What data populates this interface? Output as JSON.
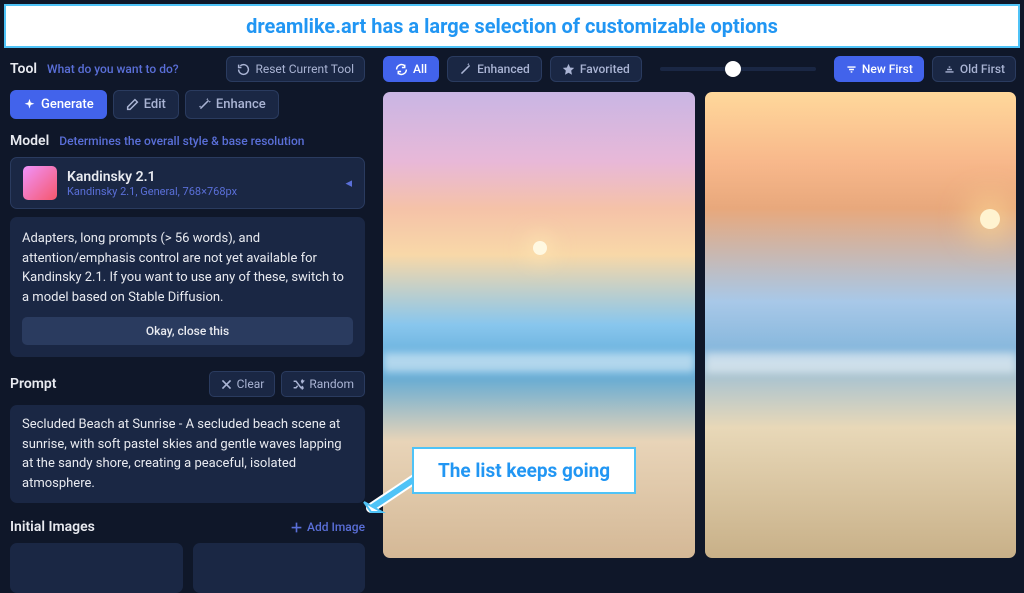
{
  "annotations": {
    "top": "dreamlike.art has a large selection of customizable options",
    "list": "The list keeps going"
  },
  "sidebar": {
    "tool": {
      "label": "Tool",
      "hint": "What do you want to do?",
      "reset": "Reset Current Tool",
      "generate": "Generate",
      "edit": "Edit",
      "enhance": "Enhance"
    },
    "model": {
      "label": "Model",
      "hint": "Determines the overall style & base resolution",
      "name": "Kandinsky 2.1",
      "details": "Kandinsky 2.1, General, 768×768px"
    },
    "notice": {
      "text": "Adapters, long prompts (> 56 words), and attention/emphasis control are not yet available for Kandinsky 2.1. If you want to use any of these, switch to a model based on Stable Diffusion.",
      "close": "Okay, close this"
    },
    "prompt": {
      "label": "Prompt",
      "clear": "Clear",
      "random": "Random",
      "text": "Secluded Beach at Sunrise - A secluded beach scene at sunrise, with soft pastel skies and gentle waves lapping at the sandy shore, creating a peaceful, isolated atmosphere."
    },
    "initial_images": {
      "label": "Initial Images",
      "add": "Add Image"
    }
  },
  "topbar": {
    "all": "All",
    "enhanced": "Enhanced",
    "favorited": "Favorited",
    "new_first": "New First",
    "old_first": "Old First"
  }
}
